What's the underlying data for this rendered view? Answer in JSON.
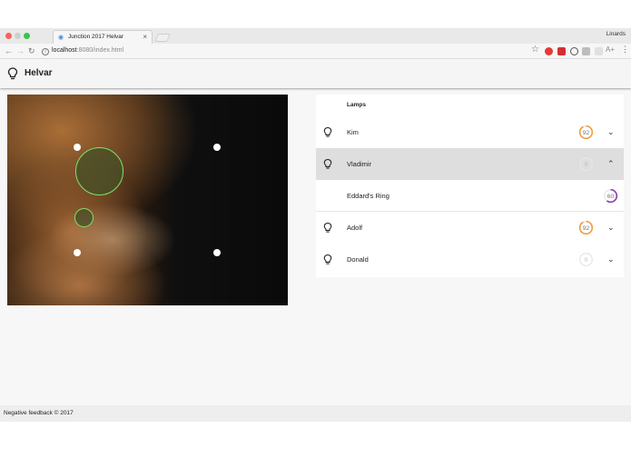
{
  "browser": {
    "tab_title": "Junction 2017 Helvar",
    "tab_close": "×",
    "user": "Linards",
    "url_host": "localhost",
    "url_path": ":8080/index.html"
  },
  "app": {
    "title": "Helvar",
    "lamps_header": "Lamps",
    "lamps": [
      {
        "name": "Kim",
        "level": 92,
        "color": "#f0a040",
        "expanded": false
      },
      {
        "name": "Vladimir",
        "level": 0,
        "color": "#d8d8d8",
        "expanded": true
      },
      {
        "name": "Eddard's Ring",
        "level": 60,
        "color": "#8e44ad",
        "child": true
      },
      {
        "name": "Adolf",
        "level": 92,
        "color": "#f0a040",
        "expanded": false
      },
      {
        "name": "Donald",
        "level": 0,
        "color": "#d8d8d8",
        "expanded": false
      }
    ],
    "footer": "Negative feedback © 2017"
  }
}
